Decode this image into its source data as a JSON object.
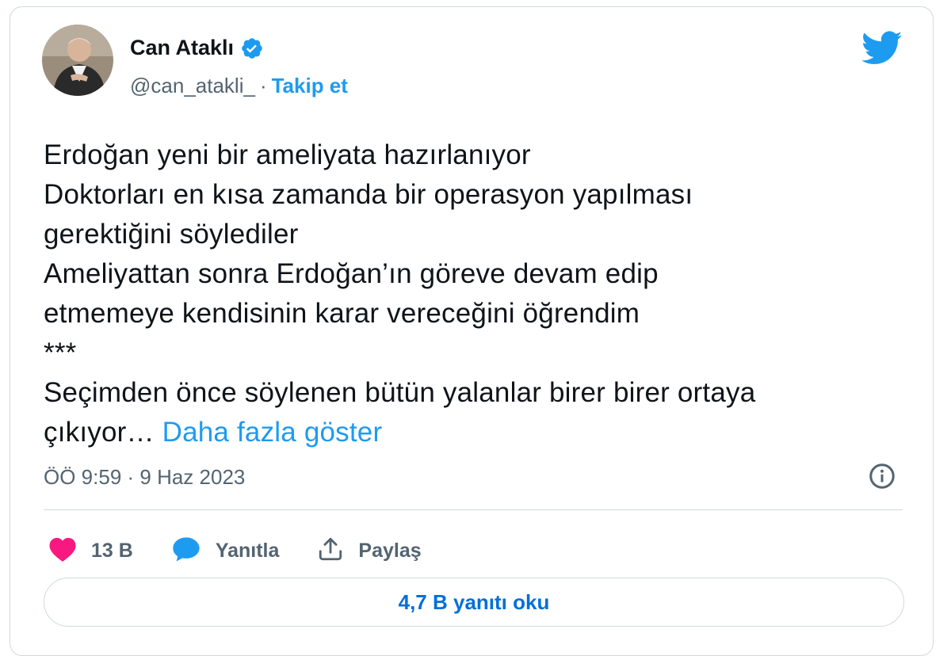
{
  "author": {
    "display_name": "Can Ataklı",
    "handle": "@can_atakli_",
    "separator": "·",
    "follow_label": "Takip et",
    "avatar_icon": "user-avatar-photo",
    "verified_icon": "verified-badge-icon"
  },
  "brand": {
    "icon": "twitter-bird-icon",
    "color": "#1d9bf0"
  },
  "tweet": {
    "lines": [
      "Erdoğan yeni bir ameliyata hazırlanıyor",
      "Doktorları en kısa zamanda bir operasyon yapılması",
      "gerektiğini söylediler",
      "Ameliyattan sonra Erdoğan’ın göreve devam edip",
      "etmemeye kendisinin karar vereceğini öğrendim",
      "***",
      "Seçimden önce söylenen bütün yalanlar birer birer ortaya"
    ],
    "last_line_text": "çıkıyor… ",
    "show_more_label": "Daha fazla göster"
  },
  "meta": {
    "timestamp": "ÖÖ 9:59 · 9 Haz 2023",
    "info_icon": "info-icon"
  },
  "actions": {
    "like_count": "13 B",
    "reply_label": "Yanıtla",
    "share_label": "Paylaş",
    "like_color": "#f91880"
  },
  "read_replies_label": "4,7 B yanıtı oku"
}
